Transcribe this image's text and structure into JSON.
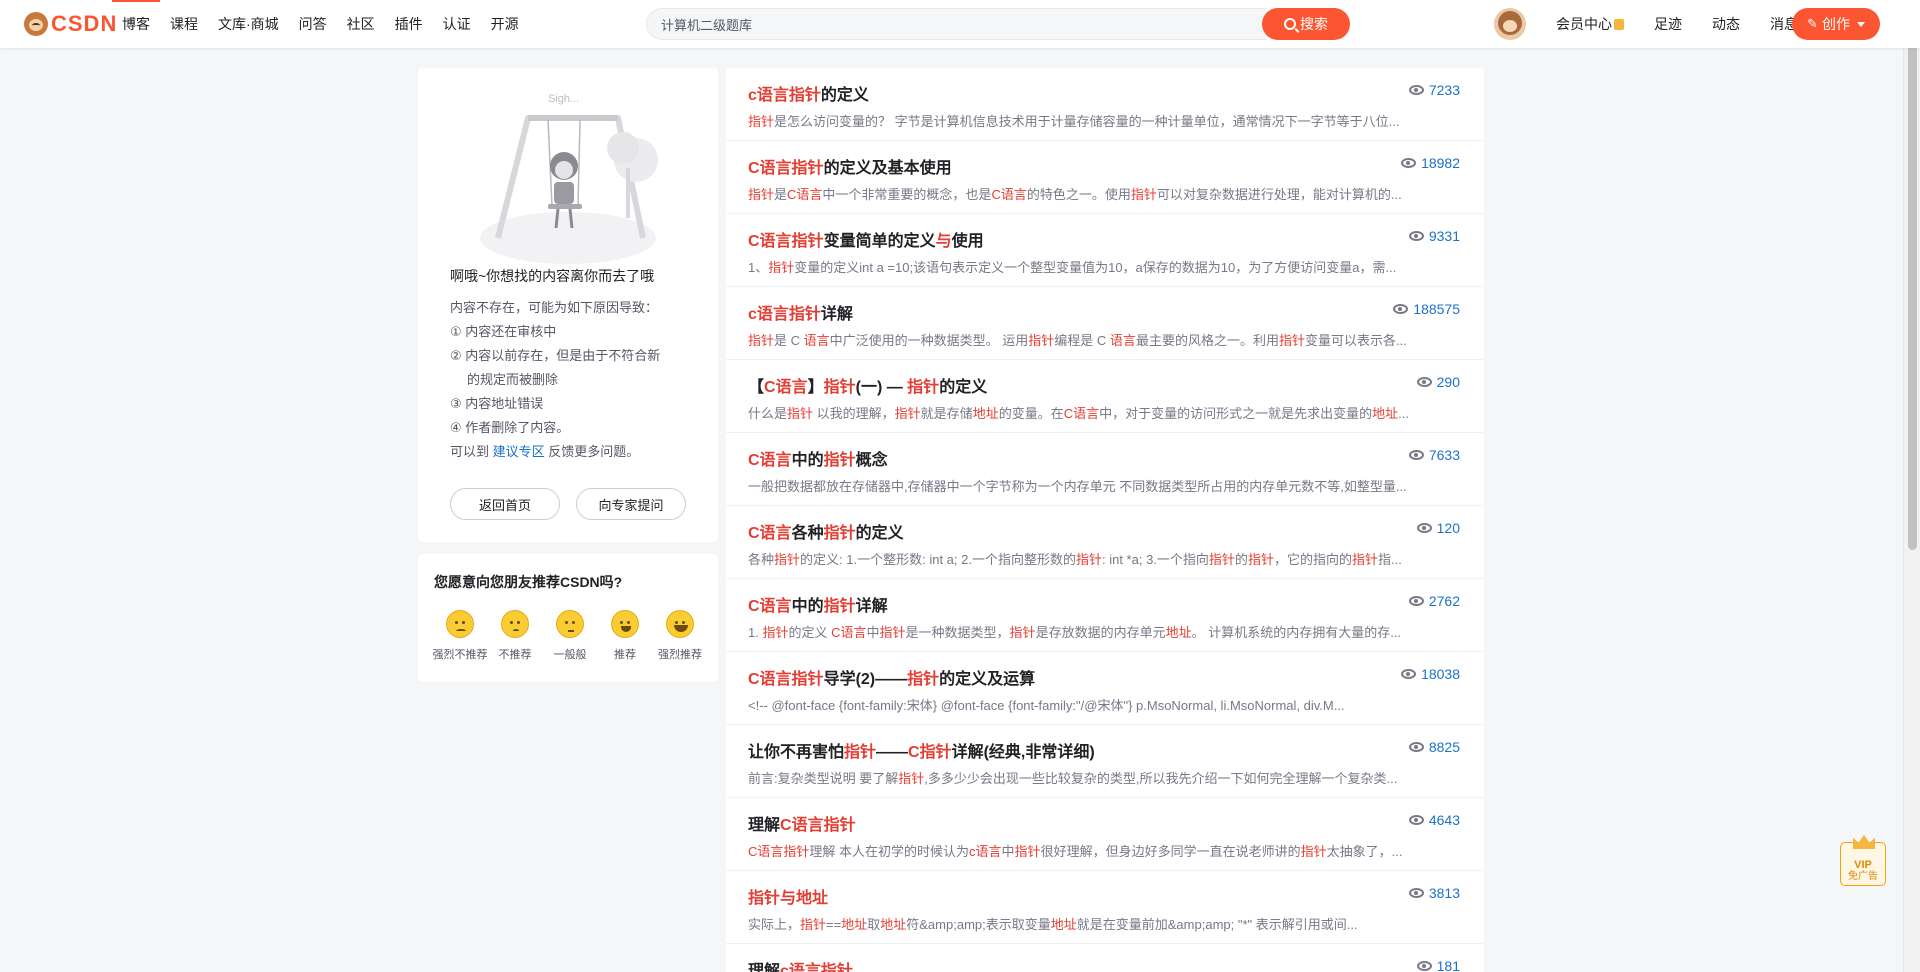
{
  "brand": {
    "logo_text": "CSDN"
  },
  "nav": [
    {
      "label": "博客",
      "active": true
    },
    {
      "label": "课程"
    },
    {
      "label": "文库·商城"
    },
    {
      "label": "问答"
    },
    {
      "label": "社区"
    },
    {
      "label": "插件"
    },
    {
      "label": "认证"
    },
    {
      "label": "开源"
    }
  ],
  "search": {
    "value": "计算机二级题库",
    "button_label": "搜索"
  },
  "header_right": {
    "vip_center": "会员中心",
    "footprint": "足迹",
    "dynamics": "动态",
    "messages": "消息",
    "create_label": "创作"
  },
  "not_found": {
    "illus_caption": "Sigh...",
    "title": "啊哦~你想找的内容离你而去了哦",
    "lead": "内容不存在，可能为如下原因导致：",
    "reasons": [
      "① 内容还在审核中",
      "② 内容以前存在，但是由于不符合新",
      "的规定而被删除",
      "③ 内容地址错误",
      "④ 作者删除了内容。"
    ],
    "feedback_prefix": "可以到",
    "feedback_link": "建议专区",
    "feedback_suffix": "反馈更多问题。",
    "btn_home": "返回首页",
    "btn_ask": "向专家提问"
  },
  "recommend": {
    "title": "您愿意向您朋友推荐CSDN吗?",
    "options": [
      "强烈不推荐",
      "不推荐",
      "一般般",
      "推荐",
      "强烈推荐"
    ]
  },
  "results": [
    {
      "title": [
        {
          "t": "c语言指针",
          "h": true
        },
        {
          "t": "的定义"
        }
      ],
      "views": "7233",
      "desc": [
        {
          "t": "指针",
          "h": true
        },
        {
          "t": "是怎么访问变量的？ 字节是计算机信息技术用于计量存储容量的一种计量单位，通常情况下一字节等于八位..."
        }
      ]
    },
    {
      "title": [
        {
          "t": "C语言指针",
          "h": true
        },
        {
          "t": "的定义及基本使用"
        }
      ],
      "views": "18982",
      "desc": [
        {
          "t": "指针",
          "h": true
        },
        {
          "t": "是"
        },
        {
          "t": "C语言",
          "h": true
        },
        {
          "t": "中一个非常重要的概念，也是"
        },
        {
          "t": "C语言",
          "h": true
        },
        {
          "t": "的特色之一。使用"
        },
        {
          "t": "指针",
          "h": true
        },
        {
          "t": "可以对复杂数据进行处理，能对计算机的..."
        }
      ]
    },
    {
      "title": [
        {
          "t": "C语言指针",
          "h": true
        },
        {
          "t": "变量简单的定义"
        },
        {
          "t": "与",
          "h": true
        },
        {
          "t": "使用"
        }
      ],
      "views": "9331",
      "desc": [
        {
          "t": "1、"
        },
        {
          "t": "指针",
          "h": true
        },
        {
          "t": "变量的定义int a =10;该语句表示定义一个整型变量值为10，a保存的数据为10，为了方便访问变量a，需..."
        }
      ]
    },
    {
      "title": [
        {
          "t": "c语言指针",
          "h": true
        },
        {
          "t": "详解"
        }
      ],
      "views": "188575",
      "desc": [
        {
          "t": "指针",
          "h": true
        },
        {
          "t": "是 C "
        },
        {
          "t": "语言",
          "h": true
        },
        {
          "t": "中广泛使用的一种数据类型。 运用"
        },
        {
          "t": "指针",
          "h": true
        },
        {
          "t": "编程是 C "
        },
        {
          "t": "语言",
          "h": true
        },
        {
          "t": "最主要的风格之一。利用"
        },
        {
          "t": "指针",
          "h": true
        },
        {
          "t": "变量可以表示各..."
        }
      ]
    },
    {
      "title": [
        {
          "t": "【"
        },
        {
          "t": "C语言",
          "h": true
        },
        {
          "t": "】"
        },
        {
          "t": "指针",
          "h": true
        },
        {
          "t": "(一) — "
        },
        {
          "t": "指针",
          "h": true
        },
        {
          "t": "的定义"
        }
      ],
      "views": "290",
      "desc": [
        {
          "t": "什么是"
        },
        {
          "t": "指针",
          "h": true
        },
        {
          "t": " 以我的理解，"
        },
        {
          "t": "指针",
          "h": true
        },
        {
          "t": "就是存储"
        },
        {
          "t": "地址",
          "h": true
        },
        {
          "t": "的变量。在"
        },
        {
          "t": "C语言",
          "h": true
        },
        {
          "t": "中，对于变量的访问形式之一就是先求出变量的"
        },
        {
          "t": "地址",
          "h": true
        },
        {
          "t": "..."
        }
      ]
    },
    {
      "title": [
        {
          "t": "C语言",
          "h": true
        },
        {
          "t": "中的"
        },
        {
          "t": "指针",
          "h": true
        },
        {
          "t": "概念"
        }
      ],
      "views": "7633",
      "desc": [
        {
          "t": "一般把数据都放在存储器中,存储器中一个字节称为一个内存单元 不同数据类型所占用的内存单元数不等,如整型量..."
        }
      ]
    },
    {
      "title": [
        {
          "t": "C语言",
          "h": true
        },
        {
          "t": "各种"
        },
        {
          "t": "指针",
          "h": true
        },
        {
          "t": "的定义"
        }
      ],
      "views": "120",
      "desc": [
        {
          "t": "各种"
        },
        {
          "t": "指针",
          "h": true
        },
        {
          "t": "的定义: 1.一个整形数: int a; 2.一个指向整形数的"
        },
        {
          "t": "指针",
          "h": true
        },
        {
          "t": ": int *a; 3.一个指向"
        },
        {
          "t": "指针",
          "h": true
        },
        {
          "t": "的"
        },
        {
          "t": "指针",
          "h": true
        },
        {
          "t": "，它的指向的"
        },
        {
          "t": "指针",
          "h": true
        },
        {
          "t": "指..."
        }
      ]
    },
    {
      "title": [
        {
          "t": "C语言",
          "h": true
        },
        {
          "t": "中的"
        },
        {
          "t": "指针",
          "h": true
        },
        {
          "t": "详解"
        }
      ],
      "views": "2762",
      "desc": [
        {
          "t": "1. "
        },
        {
          "t": "指针",
          "h": true
        },
        {
          "t": "的定义 "
        },
        {
          "t": "C语言",
          "h": true
        },
        {
          "t": "中"
        },
        {
          "t": "指针",
          "h": true
        },
        {
          "t": "是一种数据类型，"
        },
        {
          "t": "指针",
          "h": true
        },
        {
          "t": "是存放数据的内存单元"
        },
        {
          "t": "地址",
          "h": true
        },
        {
          "t": "。 计算机系统的内存拥有大量的存..."
        }
      ]
    },
    {
      "title": [
        {
          "t": "C语言指针",
          "h": true
        },
        {
          "t": "导学(2)——"
        },
        {
          "t": "指针",
          "h": true
        },
        {
          "t": "的定义及运算"
        }
      ],
      "views": "18038",
      "desc": [
        {
          "t": "<!-- @font-face {font-family:宋体} @font-face {font-family:\"/@宋体\"} p.MsoNormal, li.MsoNormal, div.M..."
        }
      ]
    },
    {
      "title": [
        {
          "t": "让你不再害怕"
        },
        {
          "t": "指针",
          "h": true
        },
        {
          "t": "——"
        },
        {
          "t": "C指针",
          "h": true
        },
        {
          "t": "详解(经典,非常详细)"
        }
      ],
      "views": "8825",
      "desc": [
        {
          "t": "前言:复杂类型说明    要了解"
        },
        {
          "t": "指针",
          "h": true
        },
        {
          "t": ",多多少少会出现一些比较复杂的类型,所以我先介绍一下如何完全理解一个复杂类..."
        }
      ]
    },
    {
      "title": [
        {
          "t": "理解"
        },
        {
          "t": "C语言指针",
          "h": true
        }
      ],
      "views": "4643",
      "desc": [
        {
          "t": "C语言指针",
          "h": true
        },
        {
          "t": "理解 本人在初学的时候认为"
        },
        {
          "t": "c语言",
          "h": true
        },
        {
          "t": "中"
        },
        {
          "t": "指针",
          "h": true
        },
        {
          "t": "很好理解，但身边好多同学一直在说老师讲的"
        },
        {
          "t": "指针",
          "h": true
        },
        {
          "t": "太抽象了，..."
        }
      ]
    },
    {
      "title": [
        {
          "t": "指针与地址",
          "h": true
        }
      ],
      "views": "3813",
      "desc": [
        {
          "t": "实际上，"
        },
        {
          "t": "指针",
          "h": true
        },
        {
          "t": "=="
        },
        {
          "t": "地址",
          "h": true
        },
        {
          "t": "取"
        },
        {
          "t": "地址",
          "h": true
        },
        {
          "t": "符&amp;amp;表示取变量"
        },
        {
          "t": "地址",
          "h": true
        },
        {
          "t": "就是在变量前加&amp;amp;  \"*\" 表示解引用或间..."
        }
      ]
    },
    {
      "title": [
        {
          "t": "理解"
        },
        {
          "t": "c语言指针",
          "h": true
        }
      ],
      "views": "181",
      "desc": [
        {
          "t": ""
        }
      ]
    }
  ],
  "vip_badge": {
    "line1": "VIP",
    "line2": "免广告"
  },
  "colors": {
    "brand": "#fc5531",
    "highlight": "#e33e33",
    "link": "#1c72c8"
  }
}
